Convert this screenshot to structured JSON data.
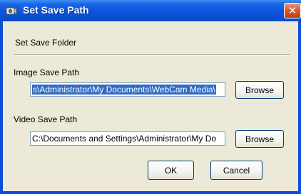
{
  "window": {
    "title": "Set Save Path",
    "close_glyph": "✕"
  },
  "dialog": {
    "section_title": "Set Save Folder",
    "image": {
      "label": "Image Save Path",
      "value": "s\\Administrator\\My Documents\\WebCam Media\\",
      "browse_label": "Browse"
    },
    "video": {
      "label": "Video Save Path",
      "value": "C:\\Documents and Settings\\Administrator\\My Do",
      "browse_label": "Browse"
    },
    "ok_label": "OK",
    "cancel_label": "Cancel"
  },
  "icons": {
    "app": "webcam-icon",
    "close": "close-icon"
  },
  "colors": {
    "titlebar": "#0a55dc",
    "selection": "#316ac5",
    "close": "#d8552d",
    "dialog_bg": "#ece9d8"
  }
}
